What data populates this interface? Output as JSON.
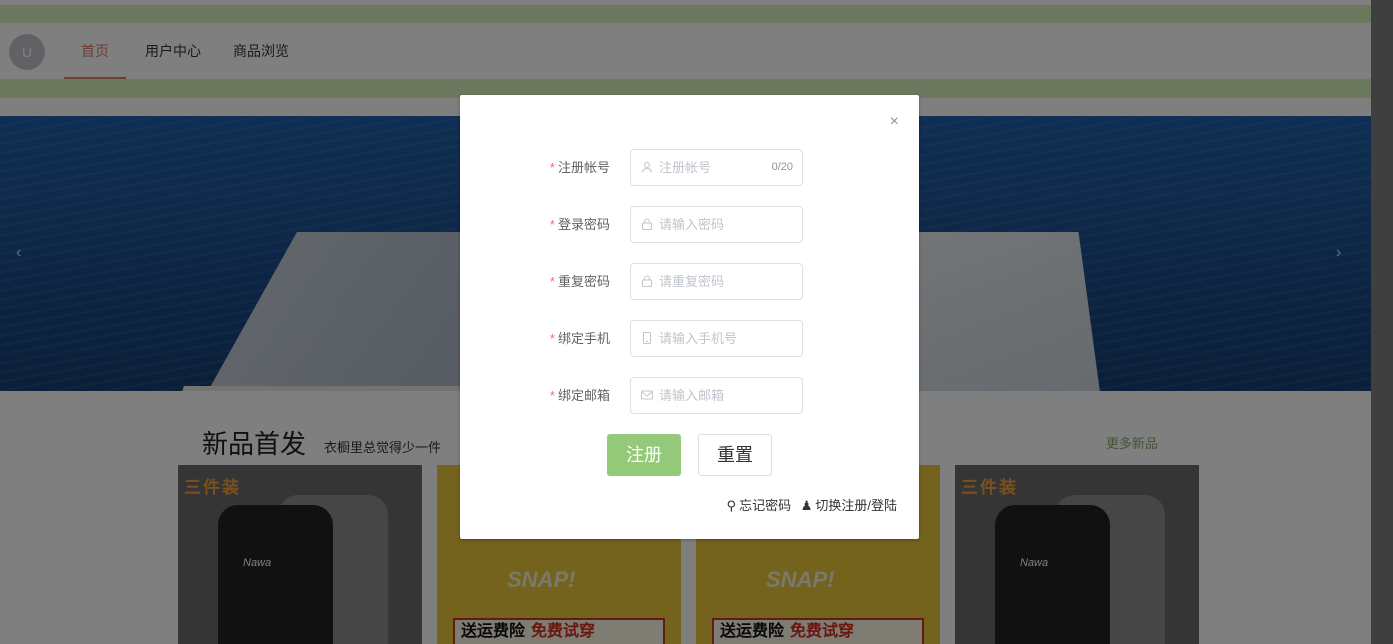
{
  "nav": {
    "avatar_letter": "U",
    "items": [
      {
        "label": "首页",
        "active": true
      },
      {
        "label": "用户中心",
        "active": false
      },
      {
        "label": "商品浏览",
        "active": false
      }
    ]
  },
  "banner": {
    "prev_arrow": "‹",
    "next_arrow": "›"
  },
  "new_products": {
    "title": "新品首发",
    "subtitle": "衣橱里总觉得少一件",
    "more": "更多新品",
    "items": [
      {
        "tag": "三件装",
        "shirt_text": "Nawa"
      },
      {
        "print": "SNAP!",
        "badge_left": "送运费险",
        "badge_right": "免费试穿"
      },
      {
        "print": "SNAP!",
        "badge_left": "送运费险",
        "badge_right": "免费试穿"
      },
      {
        "tag": "三件装",
        "shirt_text": "Nawa"
      }
    ]
  },
  "dialog": {
    "close": "×",
    "fields": [
      {
        "label": "注册帐号",
        "placeholder": "注册帐号",
        "icon": "user-icon",
        "counter": "0/20"
      },
      {
        "label": "登录密码",
        "placeholder": "请输入密码",
        "icon": "lock-icon"
      },
      {
        "label": "重复密码",
        "placeholder": "请重复密码",
        "icon": "lock-icon"
      },
      {
        "label": "绑定手机",
        "placeholder": "请输入手机号",
        "icon": "phone-icon"
      },
      {
        "label": "绑定邮箱",
        "placeholder": "请输入邮箱",
        "icon": "mail-icon"
      }
    ],
    "required_mark": "*",
    "register_button": "注册",
    "reset_button": "重置",
    "forgot_password": "忘记密码",
    "switch_login": "切换注册/登陆"
  },
  "colors": {
    "accent_green": "#95c97a",
    "nav_active": "#e07a6a",
    "required": "#f56c6c"
  }
}
